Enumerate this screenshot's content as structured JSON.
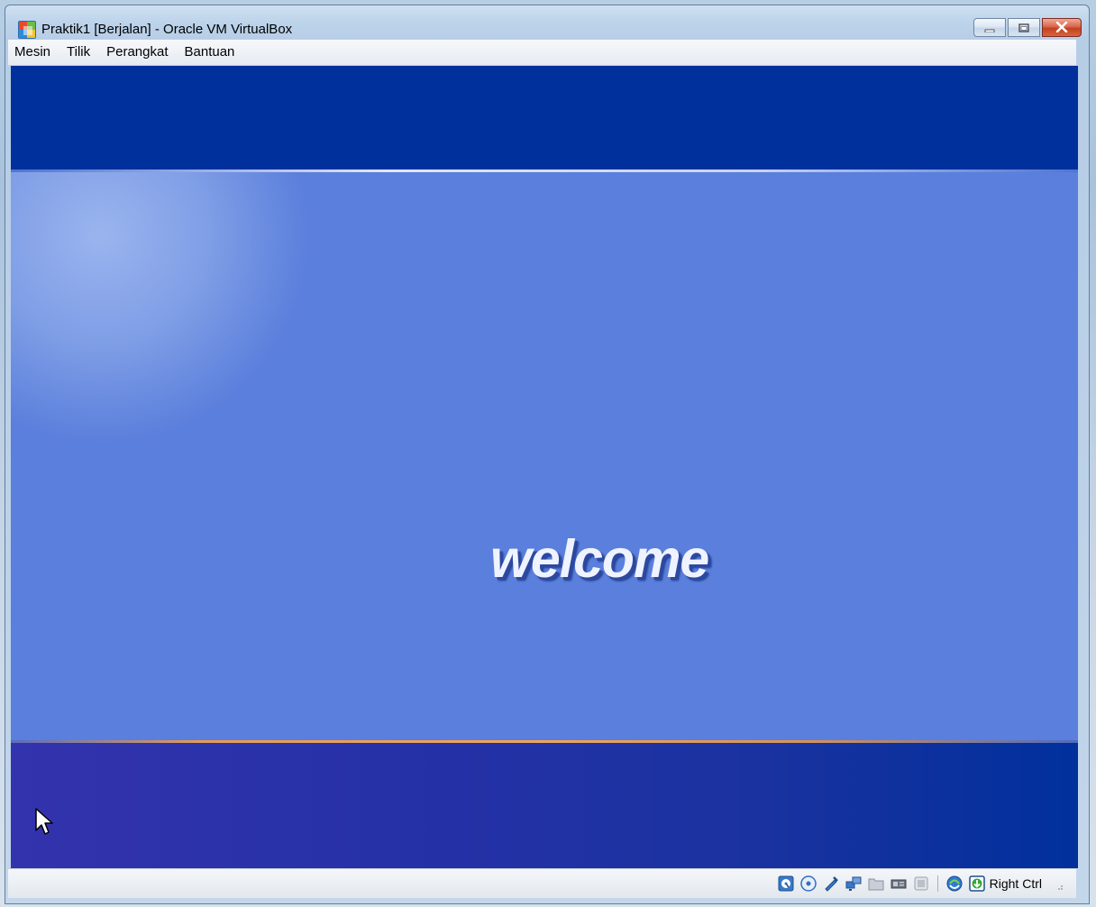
{
  "window": {
    "title": "Praktik1 [Berjalan] - Oracle VM VirtualBox",
    "app_icon": "virtualbox-icon",
    "controls": [
      "minimize-icon",
      "maximize-icon",
      "close-icon"
    ]
  },
  "menubar": {
    "items": [
      {
        "label": "Mesin"
      },
      {
        "label": "Tilik"
      },
      {
        "label": "Perangkat"
      },
      {
        "label": "Bantuan"
      }
    ]
  },
  "guest_screen": {
    "welcome_text": "welcome",
    "colors": {
      "top_band": "#00309c",
      "middle": "#5a7fdc",
      "bottom_band_start": "#3333ad",
      "bottom_band_end": "#00309c",
      "accent_line": "#f2a35c"
    }
  },
  "statusbar": {
    "icons": [
      "hard-disk-icon",
      "optical-drive-icon",
      "usb-icon",
      "network-icon",
      "shared-folder-icon",
      "display-icon",
      "video-capture-icon",
      "mouse-integration-icon",
      "keyboard-capture-icon"
    ],
    "host_key": "Right Ctrl"
  }
}
